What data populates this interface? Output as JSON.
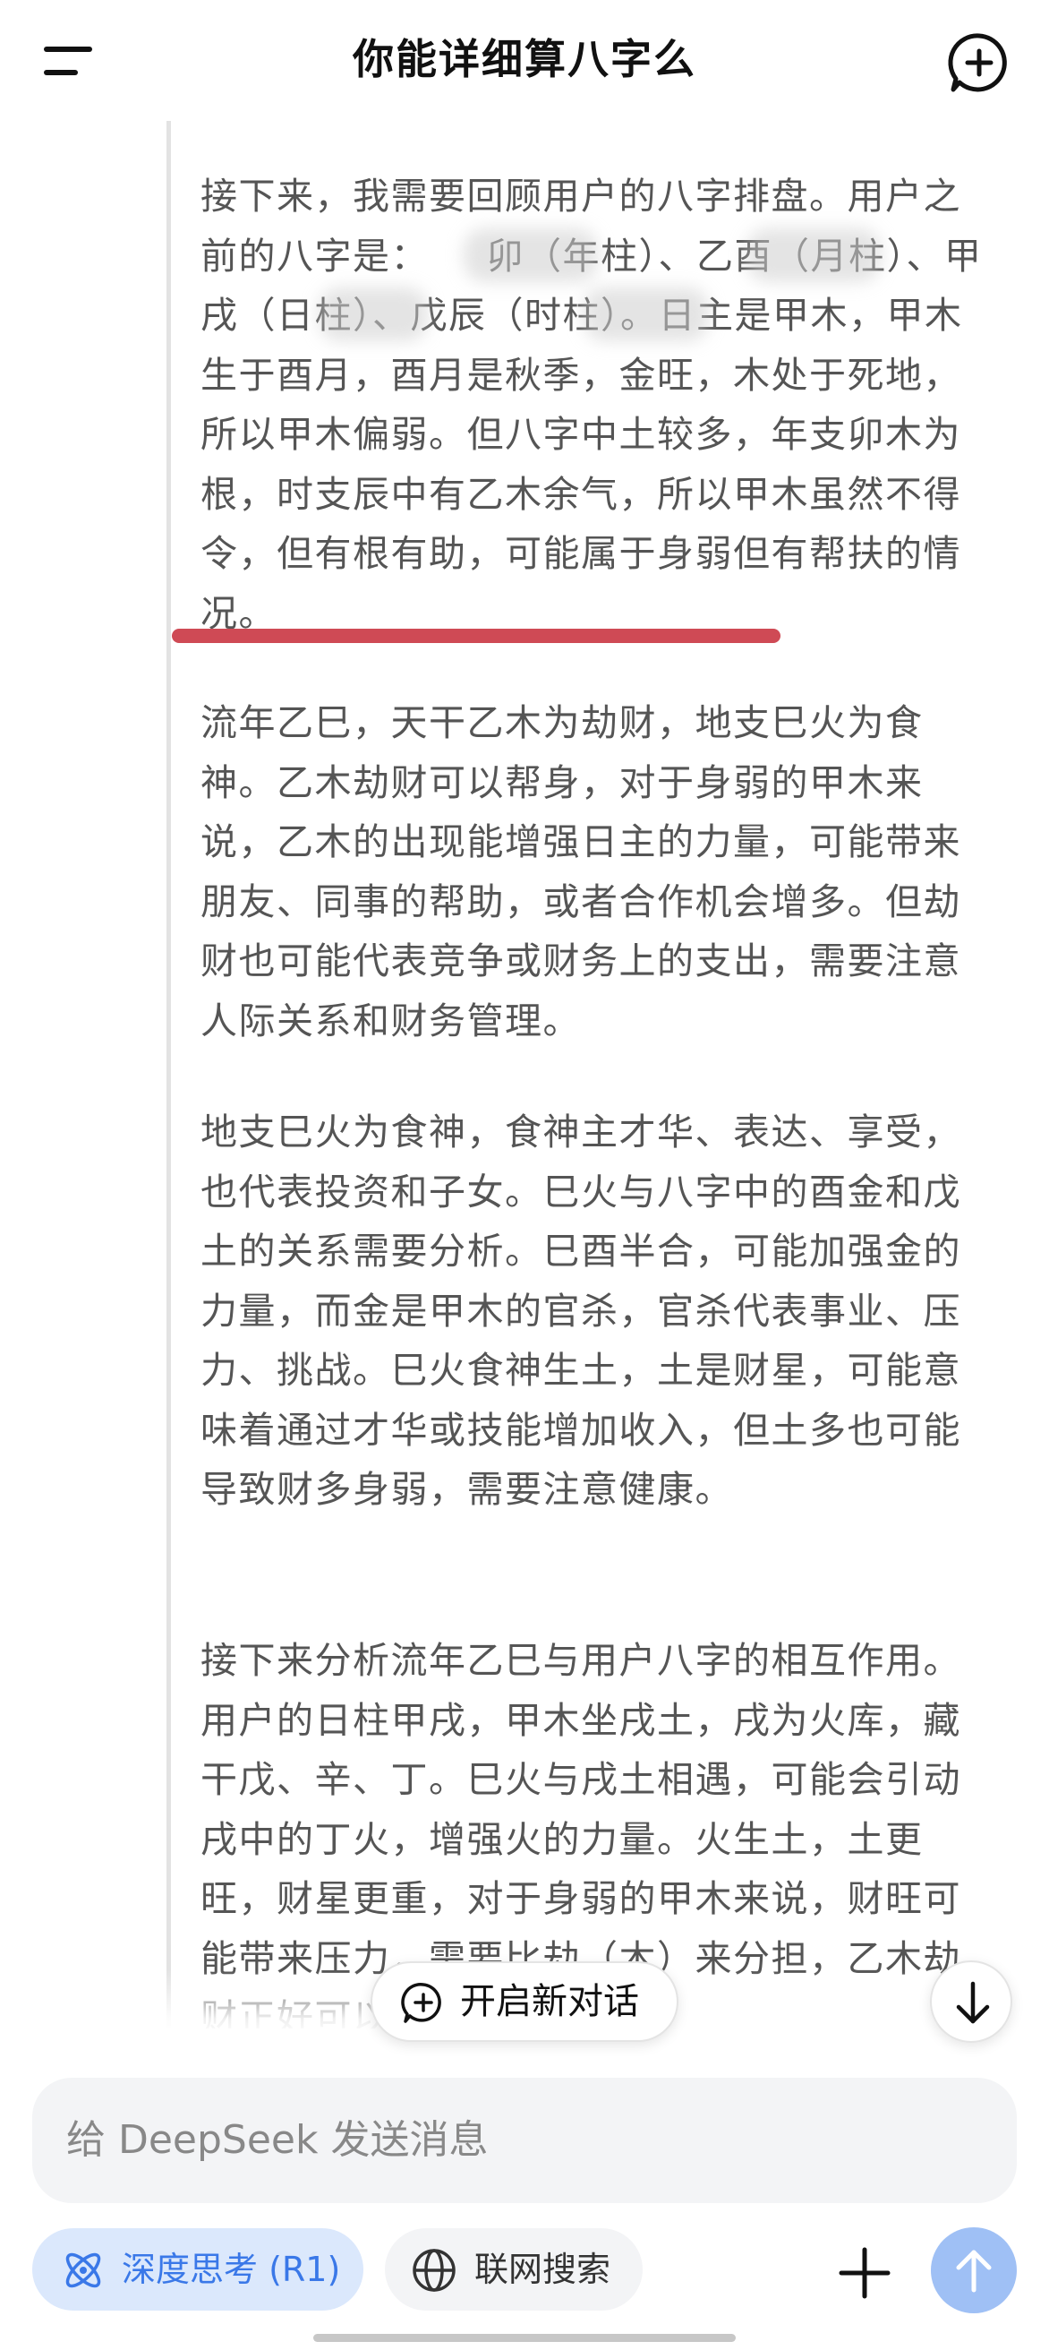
{
  "header": {
    "title": "你能详细算八字么"
  },
  "thinking": {
    "paragraphs": [
      "接下来，我需要回顾用户的八字排盘。用户之前的八字是：　　卯（年柱）、乙酉（月柱）、甲戌（日柱）、戊辰（时柱）。日主是甲木，甲木生于酉月，酉月是秋季，金旺，木处于死地，所以甲木偏弱。但八字中土较多，年支卯木为根，时支辰中有乙木余气，所以甲木虽然不得令，但有根有助，可能属于身弱但有帮扶的情况。",
      "流年乙巳，天干乙木为劫财，地支巳火为食神。乙木劫财可以帮身，对于身弱的甲木来说，乙木的出现能增强日主的力量，可能带来朋友、同事的帮助，或者合作机会增多。但劫财也可能代表竞争或财务上的支出，需要注意人际关系和财务管理。",
      "地支巳火为食神，食神主才华、表达、享受，也代表投资和子女。巳火与八字中的酉金和戊土的关系需要分析。巳酉半合，可能加强金的力量，而金是甲木的官杀，官杀代表事业、压力、挑战。巳火食神生土，土是财星，可能意味着通过才华或技能增加收入，但土多也可能导致财多身弱，需要注意健康。",
      "接下来分析流年乙巳与用户八字的相互作用。用户的日柱甲戌，甲木坐戌土，戌为火库，藏干戊、辛、丁。巳火与戌土相遇，可能会引动戌中的丁火，增强火的力量。火生土，土更旺，财星更重，对于身弱的甲木来说，财旺可能带来压力，需要比劫（木）来分担，乙木劫财正好可以帮身，但"
    ]
  },
  "floating": {
    "new_chat_label": "开启新对话"
  },
  "input": {
    "placeholder": "给 DeepSeek 发送消息"
  },
  "toolbar": {
    "deep_think_label": "深度思考 (R1)",
    "web_search_label": "联网搜索"
  },
  "colors": {
    "accent": "#3a78e8",
    "accent_bg": "#dbe8fc",
    "send_button": "#9fc0f5",
    "underline": "#cf4a55",
    "thinking_text": "#555555"
  },
  "icons": {
    "menu": "menu-icon",
    "new_chat": "new-chat-icon",
    "scroll_down": "arrow-down-icon",
    "deep_think": "atom-icon",
    "web_search": "globe-icon",
    "attach": "plus-icon",
    "send": "arrow-up-icon"
  }
}
